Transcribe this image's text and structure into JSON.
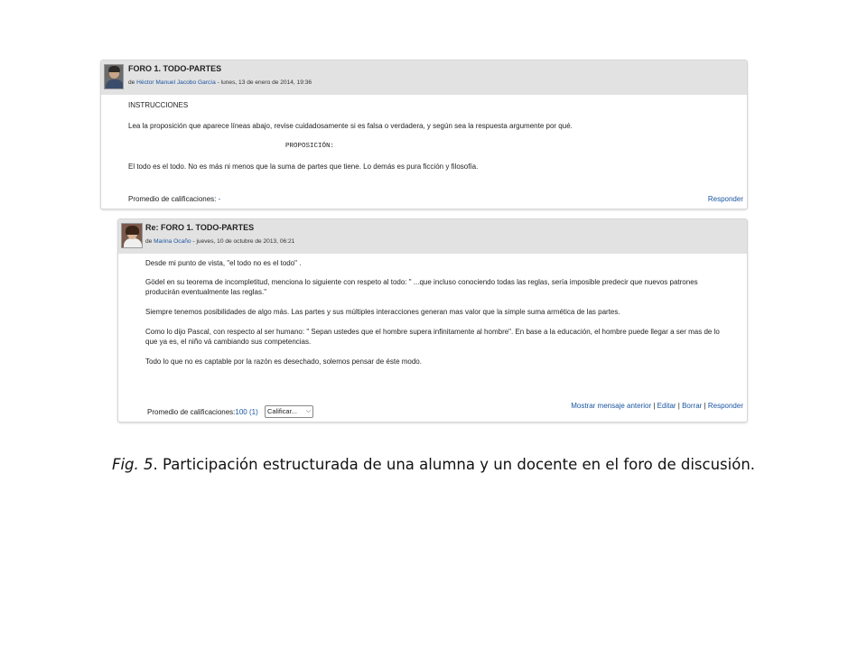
{
  "post1": {
    "title": "FORO 1. TODO-PARTES",
    "meta_prefix": "de ",
    "author": "Héctor Manuel Jacobo García",
    "meta_date": " - lunes, 13 de enero de 2014, 19:36",
    "paragraphs": [
      "INSTRUCCIONES",
      "Lea la proposición que aparece líneas abajo, revise cuidadosamente si es falsa o verdadera, y según sea la respuesta argumente por qué.",
      "PROPOSICIÓN:",
      "El todo es el todo. No es más ni menos que la suma de partes que tiene. Lo demás es pura ficción y filosofía."
    ],
    "rating_label": "Promedio de calificaciones:",
    "rating_value": " -",
    "reply_link": "Responder"
  },
  "post2": {
    "title": "Re: FORO 1. TODO-PARTES",
    "meta_prefix": "de ",
    "author": "Marina Ocaño",
    "meta_date": " - jueves, 10 de octubre de 2013, 06:21",
    "paragraphs": [
      "Desde mi punto de vista, \"el todo no es el todo\" .",
      "Gödel en su teorema de incompletitud, menciona lo siguiente con respeto al todo: \" ...que incluso conociendo todas las reglas, sería imposible predecir que nuevos patrones",
      "producirán eventualmente las reglas.\"",
      "Siempre tenemos posibilidades de algo más. Las partes y sus múltiples interacciones generan mas valor que la simple suma armética de las partes.",
      "Como lo dijo Pascal, con respecto al ser humano: \" Sepan ustedes que el hombre supera infinitamente al hombre\". En base a la educación, el hombre puede llegar a ser mas de lo",
      "que ya es, el niño vá cambiando sus competencias.",
      "Todo lo que no es captable por la razón es desechado, solemos pensar de éste modo."
    ],
    "rating_label": "Promedio de calificaciones:",
    "rating_value": "100 (1)",
    "rate_select": "Calificar...",
    "actions": [
      "Mostrar mensaje anterior",
      "Editar",
      "Borrar",
      "Responder"
    ],
    "separator": " | "
  },
  "caption": {
    "fig_label": "Fig. 5",
    "text": ". Participación estructurada de una alumna y un docente en el foro de discusión."
  },
  "icons": {
    "avatar1": "user-photo-icon",
    "avatar2": "user-photo-icon",
    "dropdown": "chevron-down-icon"
  },
  "colors": {
    "link": "#1a55a0",
    "header_bg": "#e2e2e2"
  }
}
